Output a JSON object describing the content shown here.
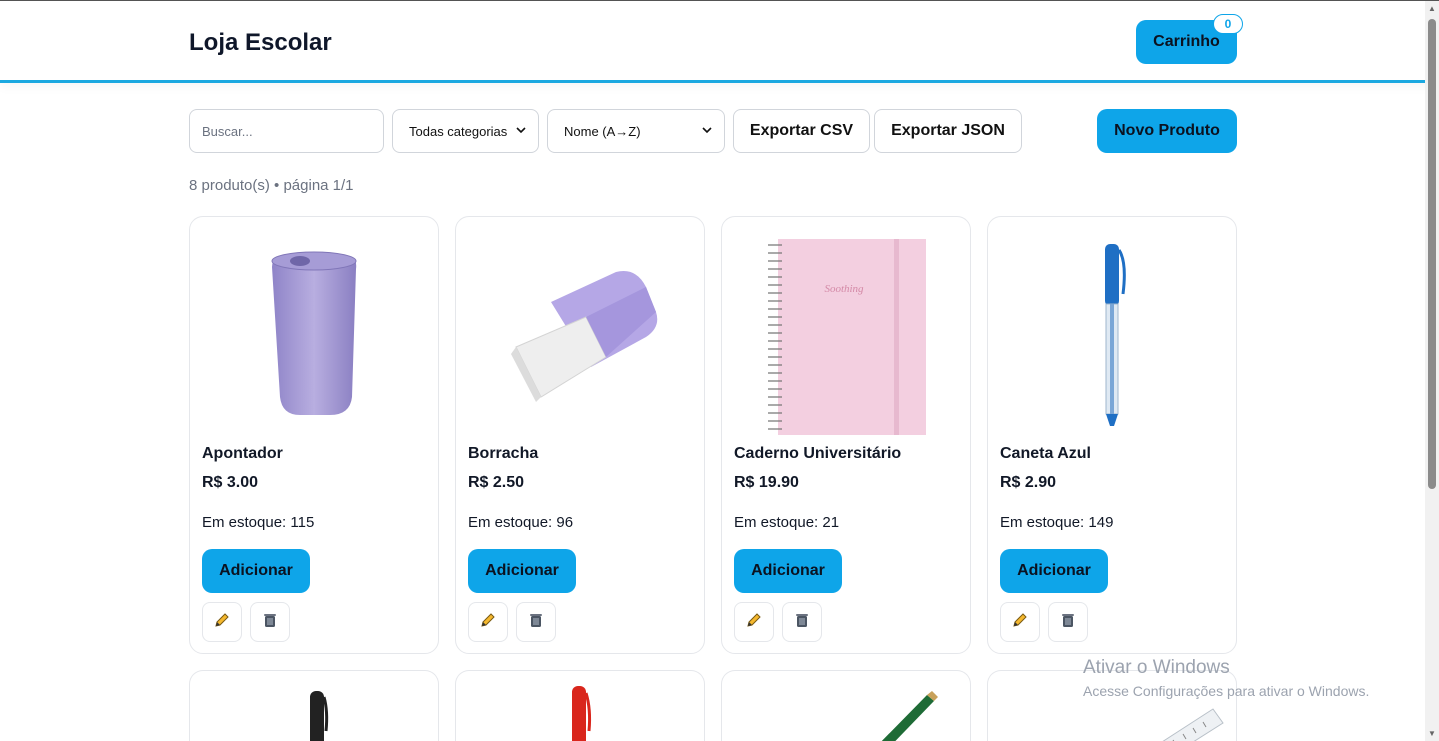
{
  "header": {
    "brand": "Loja Escolar",
    "cart_label": "Carrinho",
    "cart_count": "0"
  },
  "toolbar": {
    "search_placeholder": "Buscar...",
    "category_selected": "Todas categorias",
    "sort_selected": "Nome (A→Z)",
    "export_csv": "Exportar CSV",
    "export_json": "Exportar JSON",
    "new_product": "Novo Produto"
  },
  "summary": "8 produto(s) • página 1/1",
  "products": [
    {
      "name": "Apontador",
      "price": "R$ 3.00",
      "stock": "Em estoque: 115",
      "add": "Adicionar",
      "image_icon": "sharpener-icon"
    },
    {
      "name": "Borracha",
      "price": "R$ 2.50",
      "stock": "Em estoque: 96",
      "add": "Adicionar",
      "image_icon": "eraser-icon"
    },
    {
      "name": "Caderno Universitário",
      "price": "R$ 19.90",
      "stock": "Em estoque: 21",
      "add": "Adicionar",
      "image_icon": "notebook-icon",
      "image_text": "Soothing"
    },
    {
      "name": "Caneta Azul",
      "price": "R$ 2.90",
      "stock": "Em estoque: 149",
      "add": "Adicionar",
      "image_icon": "blue-pen-icon"
    }
  ],
  "lower_products_icons": [
    "black-pen-icon",
    "red-pen-icon",
    "pencil-icon",
    "ruler-icon"
  ],
  "watermark": {
    "title": "Ativar o Windows",
    "subtitle": "Acesse Configurações para ativar o Windows."
  },
  "colors": {
    "accent": "#0ea5e9",
    "header_border": "#1ba8e0"
  }
}
